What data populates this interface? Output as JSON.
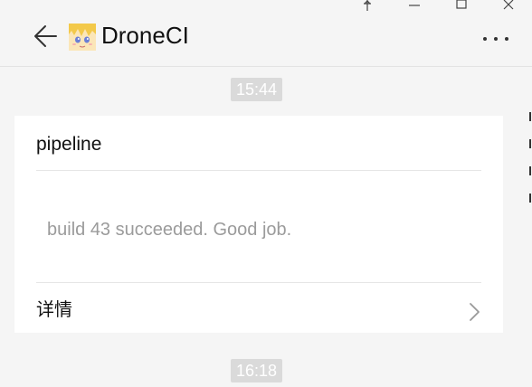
{
  "window": {
    "controls": {
      "pin_icon": "pin-icon",
      "minimize_icon": "minimize-icon",
      "maximize_icon": "maximize-icon",
      "close_icon": "close-icon"
    }
  },
  "header": {
    "back_icon": "arrow-left-icon",
    "avatar_icon": "anime-avatar",
    "title": "DroneCI",
    "more_icon": "more-dots-icon"
  },
  "messages": [
    {
      "timestamp": "15:44",
      "card": {
        "title": "pipeline",
        "body": "build 43 succeeded. Good job.",
        "details_label": "详情",
        "chevron_icon": "chevron-right-icon"
      }
    },
    {
      "timestamp": "16:18"
    }
  ],
  "colors": {
    "background": "#f5f5f5",
    "card": "#ffffff",
    "timestamp_bg": "#dadada",
    "muted_text": "#9b9b9b"
  }
}
